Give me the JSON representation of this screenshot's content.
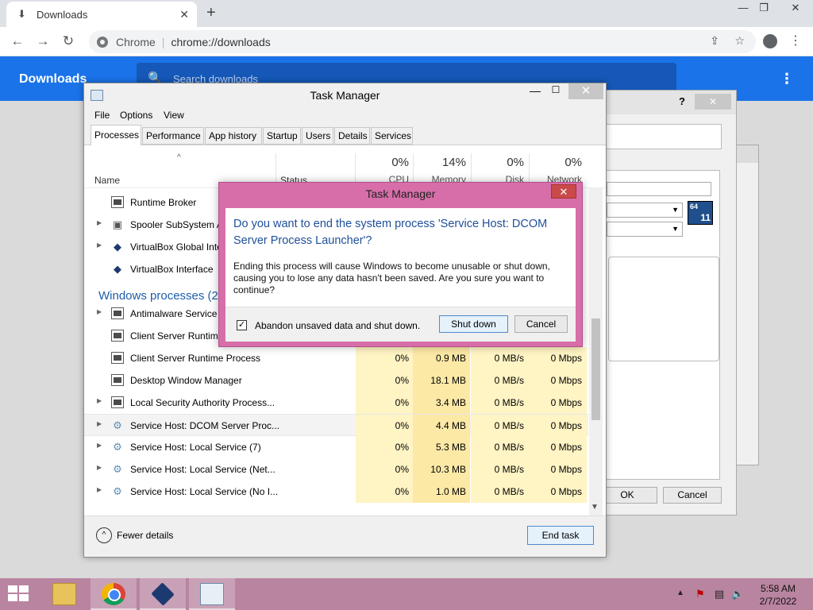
{
  "chrome": {
    "tab_title": "Downloads",
    "tab_close": "✕",
    "new_tab": "+",
    "site_name": "Chrome",
    "url": "chrome://downloads",
    "page_title": "Downloads",
    "search_placeholder": "Search downloads",
    "menu_glyph": "⋮"
  },
  "icons": {
    "download": "⬇",
    "back": "←",
    "forward": "→",
    "reload": "↻",
    "share": "⇪",
    "star": "☆",
    "menu": "⋮",
    "search": "🔍",
    "minimize": "—",
    "restore": "❐",
    "close": "✕"
  },
  "background_dialog": {
    "help": "?",
    "close": "✕",
    "badge_top": "64",
    "badge_num": "11",
    "ok_label": "OK",
    "cancel_label": "Cancel"
  },
  "task_manager": {
    "title": "Task Manager",
    "min": "—",
    "max": "☐",
    "close": "✕",
    "menu": [
      "File",
      "Options",
      "View"
    ],
    "tabs": [
      "Processes",
      "Performance",
      "App history",
      "Startup",
      "Users",
      "Details",
      "Services"
    ],
    "active_tab": "Processes",
    "columns": {
      "name": "Name",
      "status": "Status",
      "cpu_pct": "0%",
      "cpu": "CPU",
      "memory_pct": "14%",
      "memory": "Memory",
      "disk_pct": "0%",
      "disk": "Disk",
      "network_pct": "0%",
      "network": "Network"
    },
    "group_header": "Windows processes (2",
    "processes": [
      {
        "name": "Runtime Broker",
        "icon": "window-icon",
        "expand": false
      },
      {
        "name": "Spooler SubSystem A",
        "icon": "printer-icon",
        "expand": true
      },
      {
        "name": "VirtualBox Global Inte",
        "icon": "virtualbox-icon",
        "expand": true
      },
      {
        "name": "VirtualBox Interface",
        "icon": "virtualbox-icon",
        "expand": false
      },
      {
        "name": "Antimalware Service E",
        "icon": "window-icon",
        "expand": true
      },
      {
        "name": "Client Server Runtime",
        "icon": "window-icon",
        "expand": false
      },
      {
        "name": "Client Server Runtime Process",
        "icon": "window-icon",
        "expand": false,
        "cpu": "0%",
        "memory": "0.9 MB",
        "disk": "0 MB/s",
        "network": "0 Mbps"
      },
      {
        "name": "Desktop Window Manager",
        "icon": "window-icon",
        "expand": false,
        "cpu": "0%",
        "memory": "18.1 MB",
        "disk": "0 MB/s",
        "network": "0 Mbps"
      },
      {
        "name": "Local Security Authority Process...",
        "icon": "window-icon",
        "expand": true,
        "cpu": "0%",
        "memory": "3.4 MB",
        "disk": "0 MB/s",
        "network": "0 Mbps"
      },
      {
        "name": "Service Host: DCOM Server Proc...",
        "icon": "gear-icon",
        "expand": true,
        "selected": true,
        "cpu": "0%",
        "memory": "4.4 MB",
        "disk": "0 MB/s",
        "network": "0 Mbps"
      },
      {
        "name": "Service Host: Local Service (7)",
        "icon": "gear-icon",
        "expand": true,
        "cpu": "0%",
        "memory": "5.3 MB",
        "disk": "0 MB/s",
        "network": "0 Mbps"
      },
      {
        "name": "Service Host: Local Service (Net...",
        "icon": "gear-icon",
        "expand": true,
        "cpu": "0%",
        "memory": "10.3 MB",
        "disk": "0 MB/s",
        "network": "0 Mbps"
      },
      {
        "name": "Service Host: Local Service (No I...",
        "icon": "gear-icon",
        "expand": true,
        "cpu": "0%",
        "memory": "1.0 MB",
        "disk": "0 MB/s",
        "network": "0 Mbps"
      }
    ],
    "fewer_details": "Fewer details",
    "end_task": "End task"
  },
  "confirm_dialog": {
    "title": "Task Manager",
    "close": "✕",
    "heading": "Do you want to end the system process 'Service Host: DCOM Server Process Launcher'?",
    "body": "Ending this process will cause Windows to become unusable or shut down, causing you to lose any data hasn't been saved. Are you sure you want to continue?",
    "checkbox_label": "Abandon unsaved data and shut down.",
    "checkbox_checked": true,
    "checkmark": "✓",
    "shutdown_label": "Shut down",
    "cancel_label": "Cancel"
  },
  "taskbar": {
    "tray_chevron": "▲",
    "time": "5:58 AM",
    "date": "2/7/2022"
  },
  "colors": {
    "chrome_blue": "#1a73e8",
    "dialog_frame": "#d76ea9",
    "taskbar": "#b9849f",
    "metric_highlight": "#fff4c4"
  }
}
